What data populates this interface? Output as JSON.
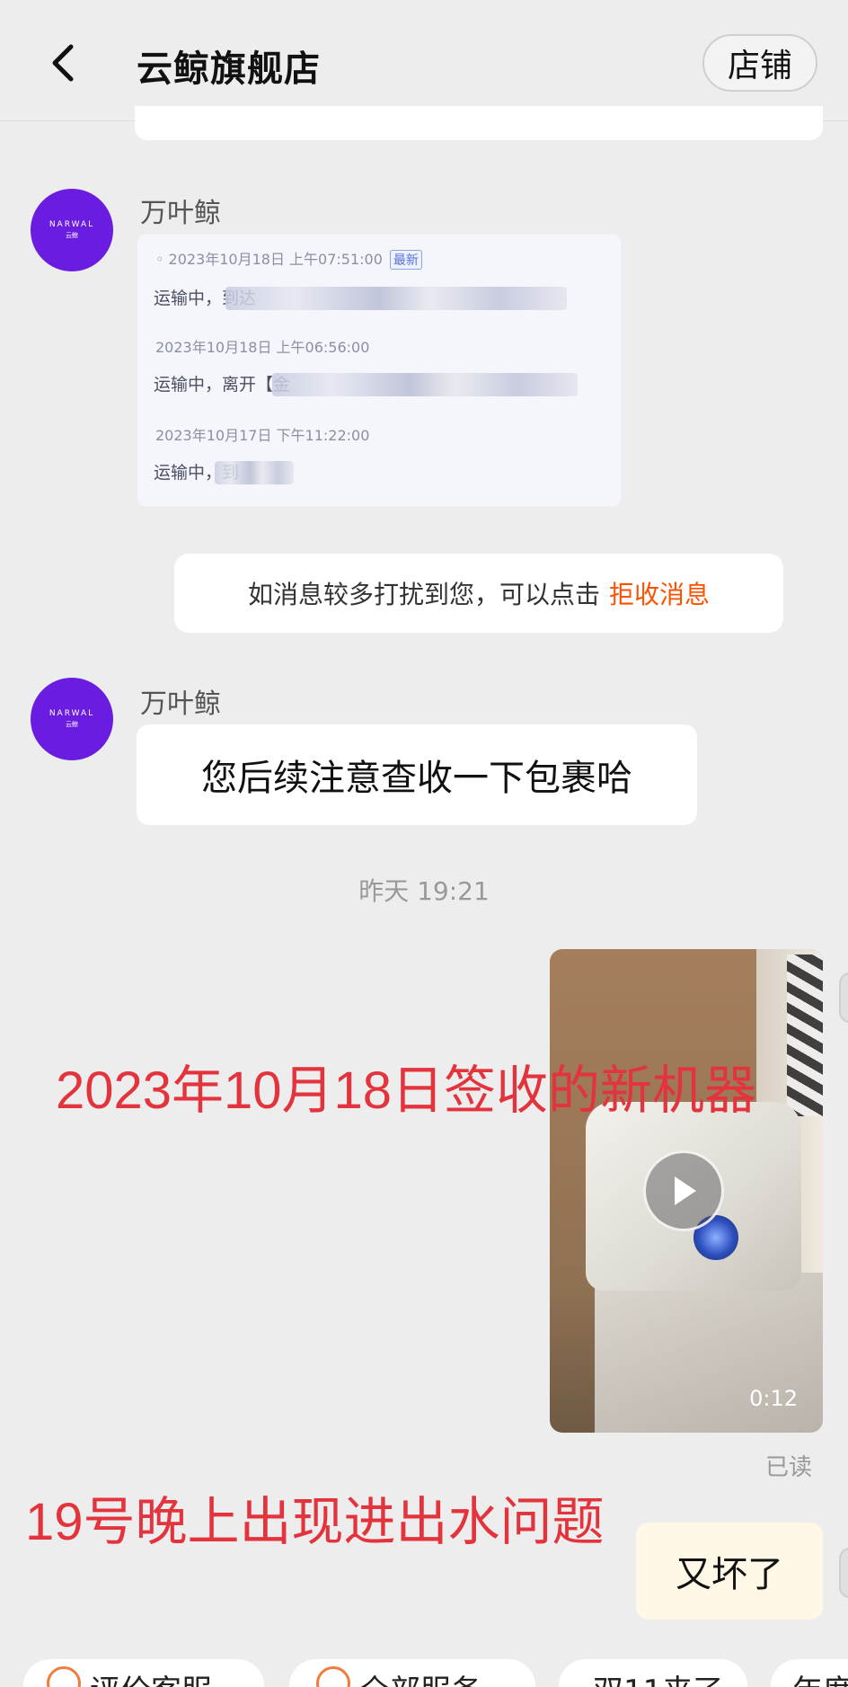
{
  "header": {
    "title": "云鲸旗舰店",
    "store_button": "店铺"
  },
  "messages": {
    "avatar_brand": "NARWAL",
    "avatar_brand_cn": "云鲸",
    "sender_name": "万叶鲸",
    "tracking": [
      {
        "time": "2023年10月18日 上午07:51:00",
        "tag": "最新",
        "status": "运输中，到达"
      },
      {
        "time": "2023年10月18日 上午06:56:00",
        "tag": "",
        "status": "运输中，离开【金"
      },
      {
        "time": "2023年10月17日 下午11:22:00",
        "tag": "",
        "status": "运输中，到"
      }
    ],
    "notice_text": "如消息较多打扰到您，可以点击",
    "notice_link": "拒收消息",
    "reply_text": "您后续注意查收一下包裹哈",
    "timestamp": "昨天 19:21",
    "video_duration": "0:12",
    "read_status": "已读",
    "user_reply": "又坏了"
  },
  "annotations": {
    "line1": "2023年10月18日签收的新机器",
    "line2": "19号晚上出现进出水问题",
    "color": "#e3343e"
  },
  "quick_replies": [
    "评价客服",
    "全部服务",
    "双11来了",
    "年度"
  ]
}
